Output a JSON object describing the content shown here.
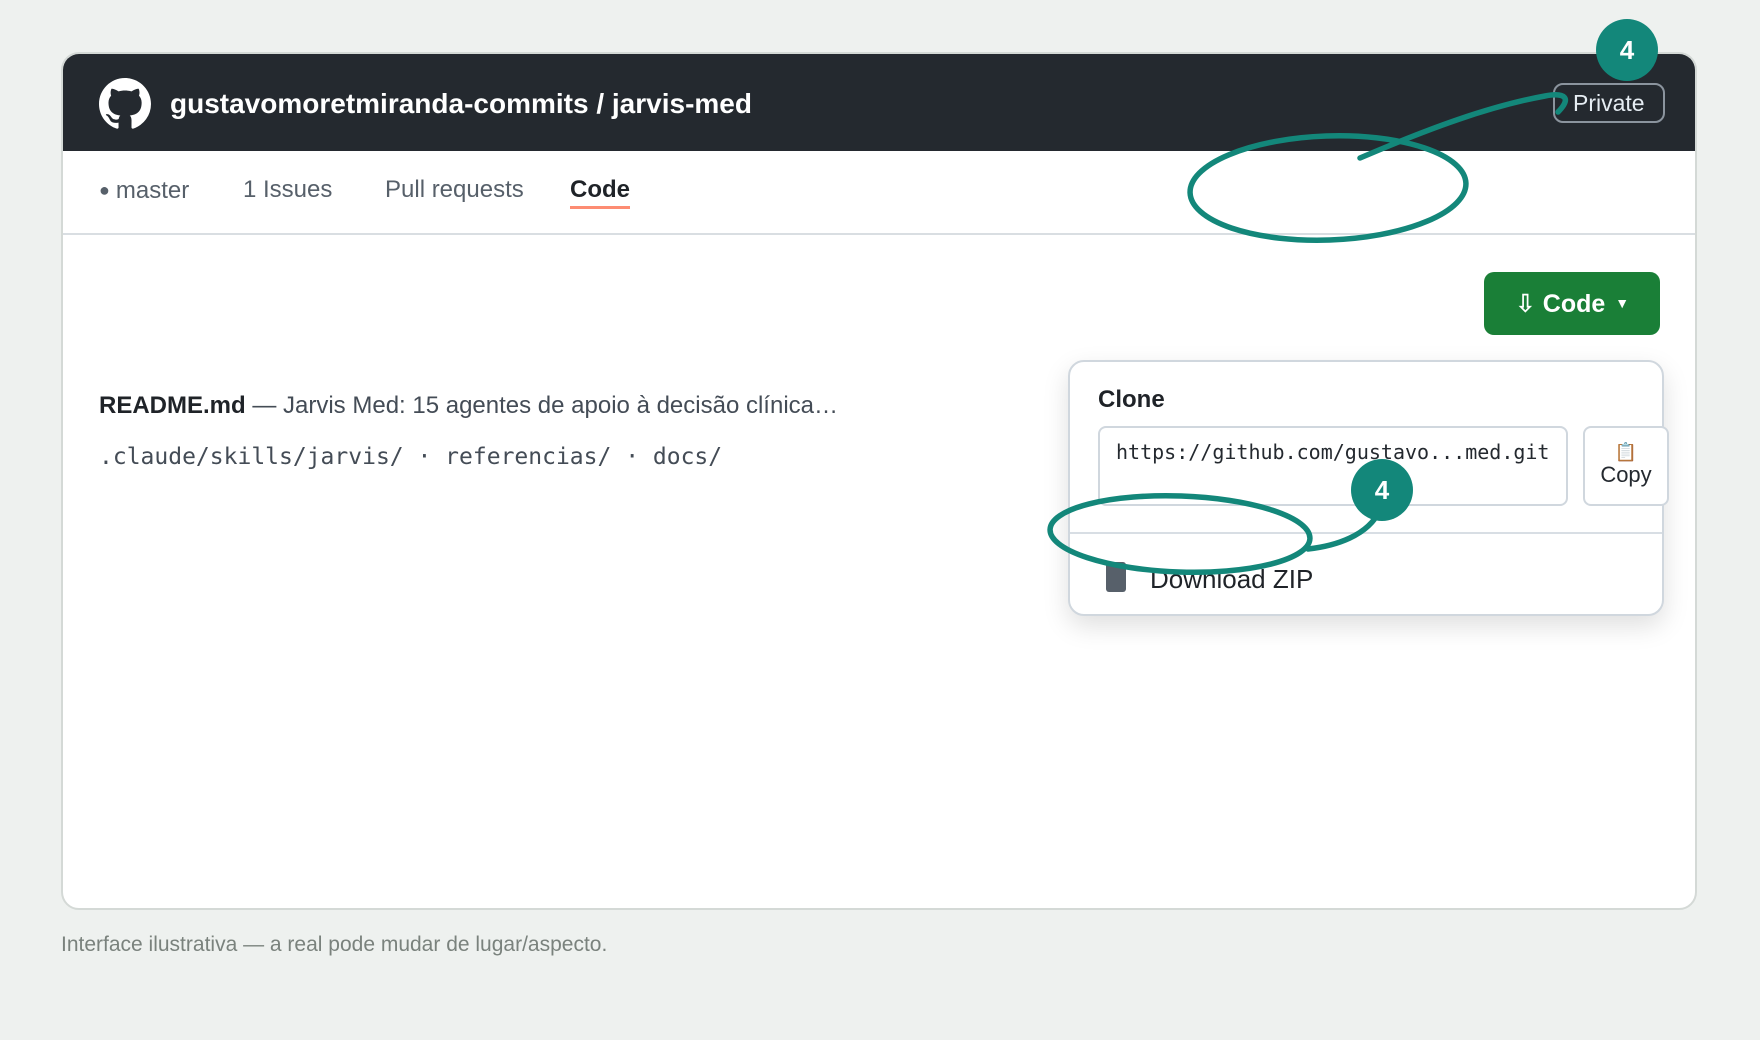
{
  "header": {
    "owner": "gustavomoretmiranda-commits",
    "separator": " / ",
    "repo": "jarvis-med",
    "visibility": "Private"
  },
  "nav": {
    "items": [
      {
        "label": "master",
        "dot": "●"
      },
      {
        "label": "1 Issues"
      },
      {
        "label": "Pull requests"
      },
      {
        "label": "Code",
        "active": true
      }
    ]
  },
  "code_button": {
    "icon": "⇩",
    "label": "Code",
    "caret": "▼"
  },
  "readme": {
    "filename": "README.md",
    "description": " — Jarvis Med: 15 agentes de apoio à decisão clínica…"
  },
  "paths": ".claude/skills/jarvis/ · referencias/ · docs/",
  "clone_popup": {
    "title": "Clone",
    "url": "https://github.com/gustavo...med.git",
    "copy_label": "Copy",
    "copy_icon": "📋",
    "download_label": "Download ZIP"
  },
  "annotations": [
    {
      "number": "4"
    },
    {
      "number": "4"
    }
  ],
  "footnote": "Interface ilustrativa — a real pode mudar de lugar/aspecto.",
  "colors": {
    "header_bg": "#24292f",
    "code_button": "#1a7f37",
    "tab_underline": "#fd8c73",
    "annotation": "#13877a"
  }
}
